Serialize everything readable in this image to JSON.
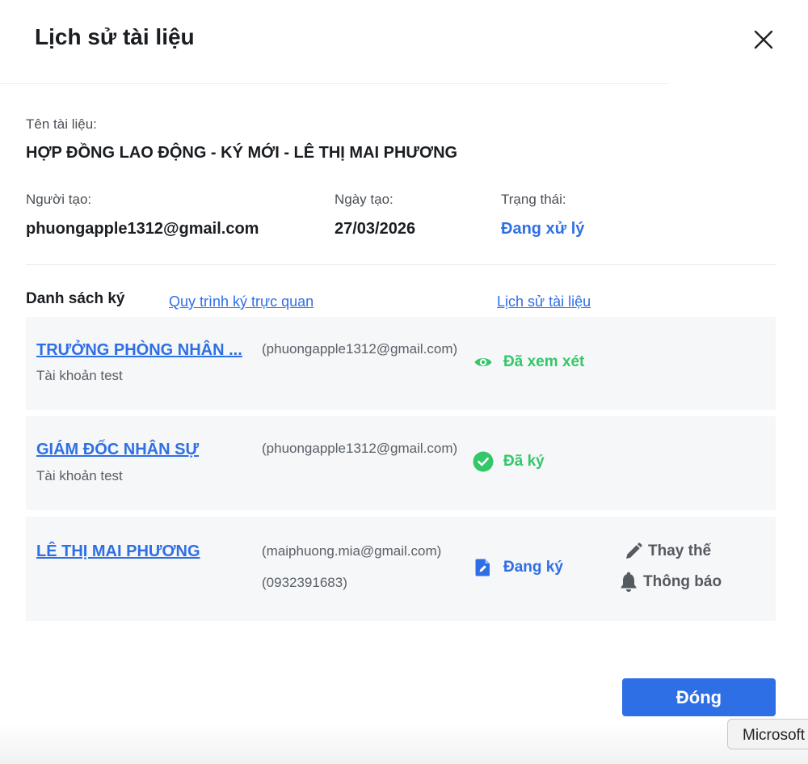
{
  "modal": {
    "title": "Lịch sử tài liệu",
    "close_icon": "close-icon"
  },
  "document": {
    "name_label": "Tên tài liệu:",
    "name_value": "HỢP ĐỒNG LAO ĐỘNG - KÝ MỚI - LÊ THỊ MAI PHƯƠNG",
    "creator_label": "Người tạo:",
    "creator_value": "phuongapple1312@gmail.com",
    "created_date_label": "Ngày tạo:",
    "created_date_value": "27/03/2026",
    "status_label": "Trạng thái:",
    "status_value": "Đang xử lý"
  },
  "signers_section": {
    "title": "Danh sách ký",
    "visual_flow_link": "Quy trình ký trực quan",
    "history_link": "Lịch sử tài liệu",
    "signers": [
      {
        "name": "TRƯỞNG PHÒNG NHÂN ...",
        "subtitle": "Tài khoản test",
        "email": "(phuongapple1312@gmail.com)",
        "status": "Đã xem xét",
        "status_icon": "eye-icon"
      },
      {
        "name": "GIÁM ĐỐC NHÂN SỰ",
        "subtitle": "Tài khoản test",
        "email": "(phuongapple1312@gmail.com)",
        "status": "Đã ký",
        "status_icon": "check-circle-icon"
      },
      {
        "name": "LÊ THỊ MAI PHƯƠNG",
        "email": "(maiphuong.mia@gmail.com)",
        "phone": "(0932391683)",
        "status": "Đang ký",
        "status_icon": "document-edit-icon",
        "actions": [
          {
            "label": "Thay thế",
            "icon": "pencil-icon"
          },
          {
            "label": "Thông báo",
            "icon": "bell-icon"
          }
        ]
      }
    ]
  },
  "footer": {
    "close_button": "Đóng"
  },
  "tooltip": {
    "text": "Microsoft"
  },
  "colors": {
    "accent": "#2f6fe5",
    "success": "#34c76a",
    "row_bg": "#f5f7f8"
  }
}
